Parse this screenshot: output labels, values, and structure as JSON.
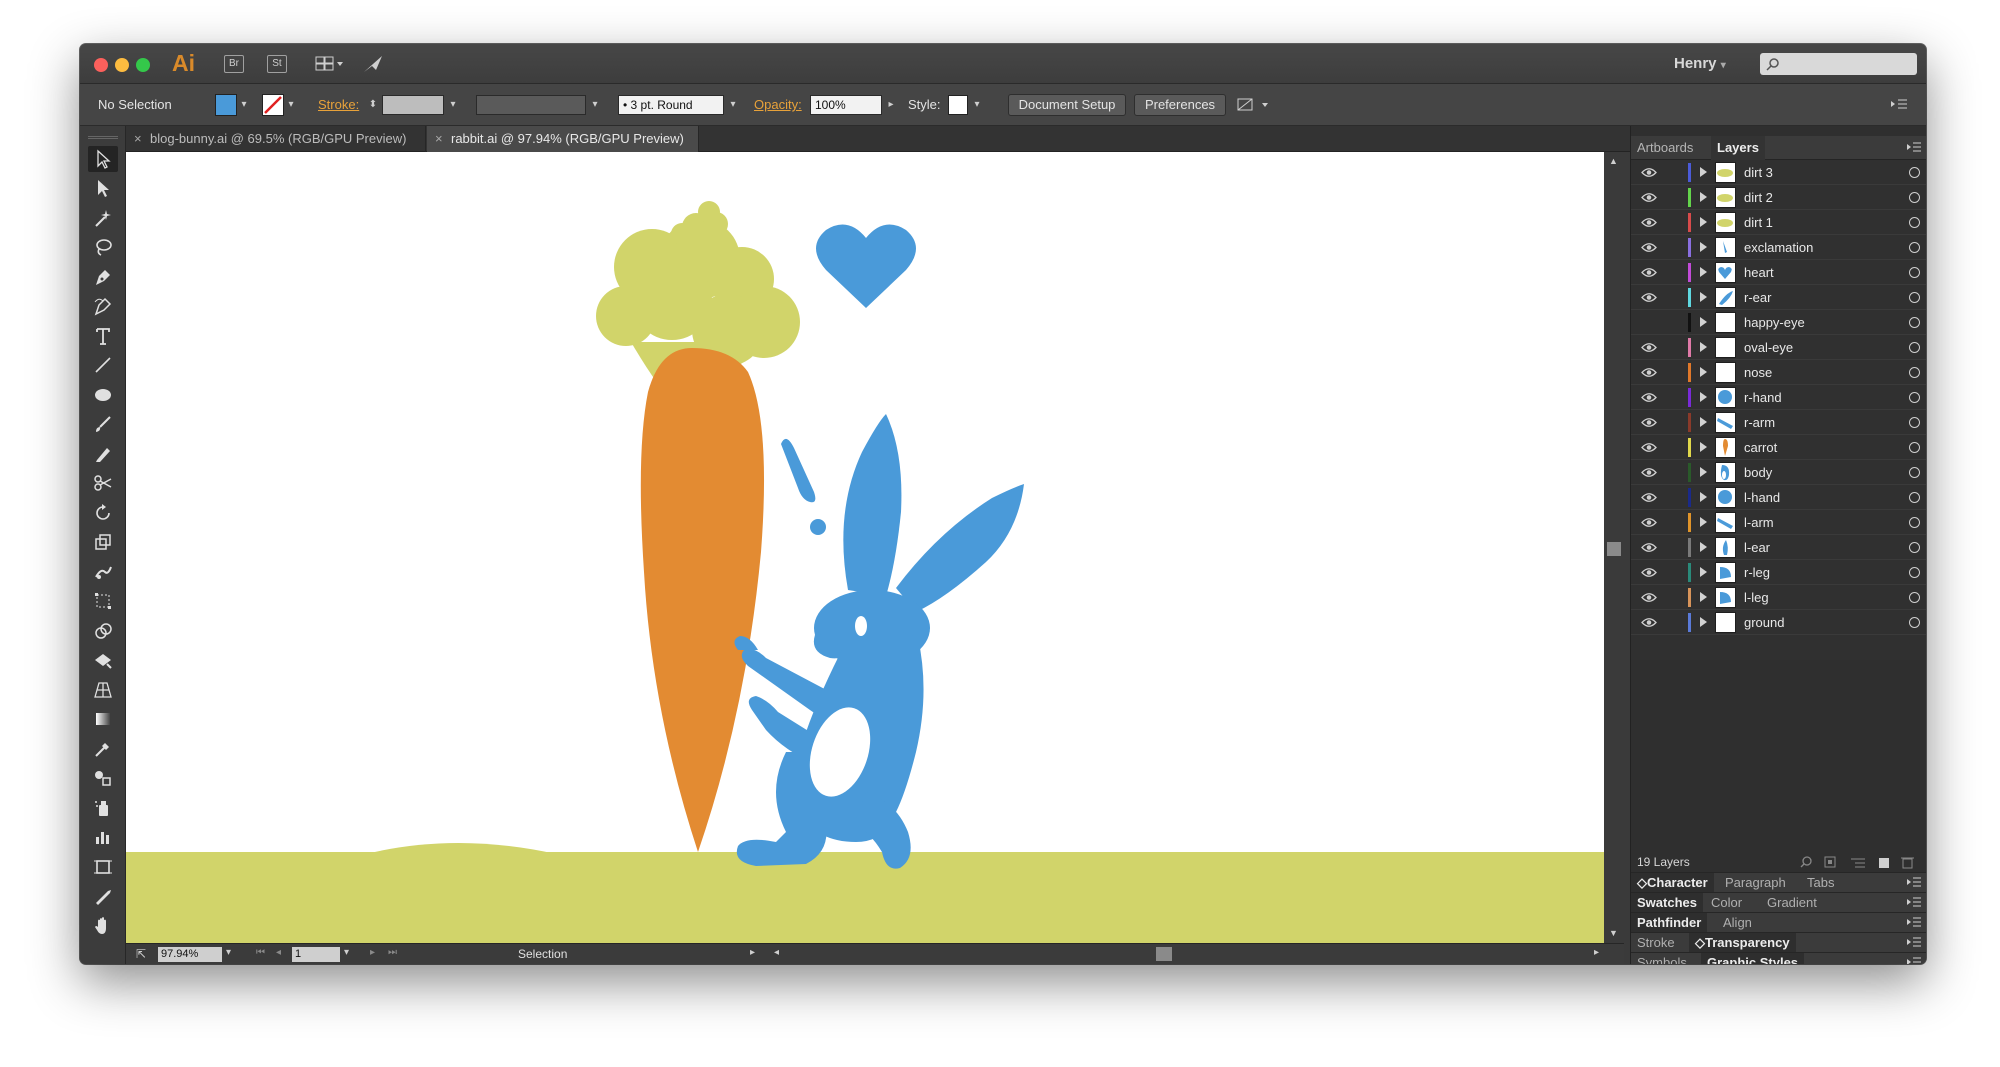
{
  "app": {
    "logo": "Ai",
    "bridge_label": "Br",
    "stock_label": "St",
    "user": "Henry",
    "user_chevron": "▾"
  },
  "controlbar": {
    "selection": "No Selection",
    "fill_color": "#4a9ad9",
    "stroke_label": "Stroke:",
    "brush_value": "3 pt. Round",
    "opacity_label": "Opacity:",
    "opacity_value": "100%",
    "style_label": "Style:",
    "document_setup": "Document Setup",
    "preferences": "Preferences"
  },
  "tabs": [
    {
      "label": "blog-bunny.ai @ 69.5% (RGB/GPU Preview)",
      "active": false
    },
    {
      "label": "rabbit.ai @ 97.94% (RGB/GPU Preview)",
      "active": true
    }
  ],
  "status": {
    "zoom": "97.94%",
    "page": "1",
    "tool_name": "Selection"
  },
  "panel": {
    "tabs": [
      "Artboards",
      "Layers"
    ],
    "active_tab": "Layers",
    "layers_count": "19 Layers",
    "layers": [
      {
        "name": "dirt 3",
        "color": "#4b5bd8",
        "visible": true,
        "thumb": "dirt"
      },
      {
        "name": "dirt 2",
        "color": "#63d44b",
        "visible": true,
        "thumb": "dirt"
      },
      {
        "name": "dirt 1",
        "color": "#d84b4b",
        "visible": true,
        "thumb": "dirt"
      },
      {
        "name": "exclamation",
        "color": "#8a6fe0",
        "visible": true,
        "thumb": "excl"
      },
      {
        "name": "heart",
        "color": "#c24bd8",
        "visible": true,
        "thumb": "heart"
      },
      {
        "name": "r-ear",
        "color": "#5fd8e0",
        "visible": true,
        "thumb": "ear"
      },
      {
        "name": "happy-eye",
        "color": "#111111",
        "visible": false,
        "thumb": "blank"
      },
      {
        "name": "oval-eye",
        "color": "#e07aa8",
        "visible": true,
        "thumb": "blank"
      },
      {
        "name": "nose",
        "color": "#e0782a",
        "visible": true,
        "thumb": "blank"
      },
      {
        "name": "r-hand",
        "color": "#7a2ad8",
        "visible": true,
        "thumb": "hand"
      },
      {
        "name": "r-arm",
        "color": "#8a3a2a",
        "visible": true,
        "thumb": "arm"
      },
      {
        "name": "carrot",
        "color": "#e0d84b",
        "visible": true,
        "thumb": "carrot"
      },
      {
        "name": "body",
        "color": "#2a5a2a",
        "visible": true,
        "thumb": "body"
      },
      {
        "name": "l-hand",
        "color": "#1a2a8a",
        "visible": true,
        "thumb": "hand"
      },
      {
        "name": "l-arm",
        "color": "#e0942a",
        "visible": true,
        "thumb": "arm"
      },
      {
        "name": "l-ear",
        "color": "#7a7a7a",
        "visible": true,
        "thumb": "lear"
      },
      {
        "name": "r-leg",
        "color": "#2a8a7a",
        "visible": true,
        "thumb": "leg"
      },
      {
        "name": "l-leg",
        "color": "#d8945a",
        "visible": true,
        "thumb": "leg"
      },
      {
        "name": "ground",
        "color": "#5a7ad8",
        "visible": true,
        "thumb": "blank"
      }
    ],
    "stacks": [
      {
        "tabs": [
          "Character",
          "Paragraph",
          "Tabs"
        ],
        "active": 0,
        "active_prefix": "◇"
      },
      {
        "tabs": [
          "Swatches",
          "Color",
          "Gradient"
        ],
        "active": 0,
        "active_prefix": ""
      },
      {
        "tabs": [
          "Pathfinder",
          "Align"
        ],
        "active": 0,
        "active_prefix": ""
      },
      {
        "tabs": [
          "Stroke",
          "Transparency"
        ],
        "active": 1,
        "active_prefix": "◇"
      },
      {
        "tabs": [
          "Symbols",
          "Graphic Styles"
        ],
        "active": 1,
        "active_prefix": ""
      }
    ]
  },
  "colors": {
    "rabbit": "#4a9ad9",
    "carrot": "#e38b32",
    "leaves": "#d1d46a",
    "ground": "#d1d46a",
    "accent_orange": "#e8a23a"
  },
  "icons": [
    "selection-tool-icon",
    "direct-selection-tool-icon",
    "magic-wand-icon",
    "lasso-icon",
    "pen-icon",
    "curvature-icon",
    "type-icon",
    "line-icon",
    "ellipse-icon",
    "paintbrush-icon",
    "pencil-icon",
    "scissors-icon",
    "rotate-icon",
    "scale-icon",
    "warp-icon",
    "free-transform-icon",
    "shape-builder-icon",
    "live-paint-icon",
    "perspective-icon",
    "gradient-icon",
    "eyedropper-icon",
    "blend-icon",
    "symbol-sprayer-icon",
    "graph-icon",
    "artboard-icon",
    "slice-icon",
    "hand-icon"
  ]
}
